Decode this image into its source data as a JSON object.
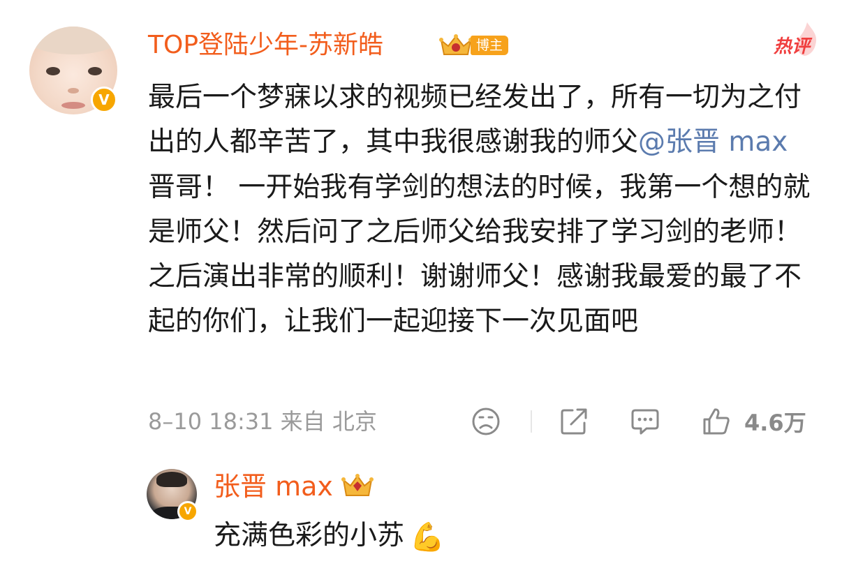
{
  "main_comment": {
    "username": "TOP登陆少年-苏新皓",
    "badge_label": "博主",
    "hot_tag": "热评",
    "text_before_mention": "最后一个梦寐以求的视频已经发出了，所有一切为之付出的人都辛苦了，其中我很感谢我的师父",
    "mention": "@张晋 max",
    "text_after_mention": " 晋哥！ 一开始我有学剑的想法的时候，我第一个想的就是师父！然后问了之后师父给我安排了学习剑的老师！ 之后演出非常的顺利！谢谢师父！感谢我最爱的最了不起的你们，让我们一起迎接下一次见面吧",
    "timestamp": "8–10 18:31",
    "source": "来自 北京",
    "like_count": "4.6万",
    "verified_mark": "V"
  },
  "reply": {
    "username": "张晋 max",
    "text": "充满色彩的小苏",
    "emoji": "💪",
    "verified_mark": "V"
  },
  "colors": {
    "username": "#f25d1c",
    "mention": "#5b7bae",
    "meta": "#9a9a9a",
    "hot_tag": "#f03e3e",
    "badge": "#f7a21b"
  },
  "icons": {
    "dislike": "frown-face-icon",
    "share": "share-icon",
    "comment": "comment-icon",
    "like": "thumbs-up-icon",
    "crown": "crown-icon"
  }
}
